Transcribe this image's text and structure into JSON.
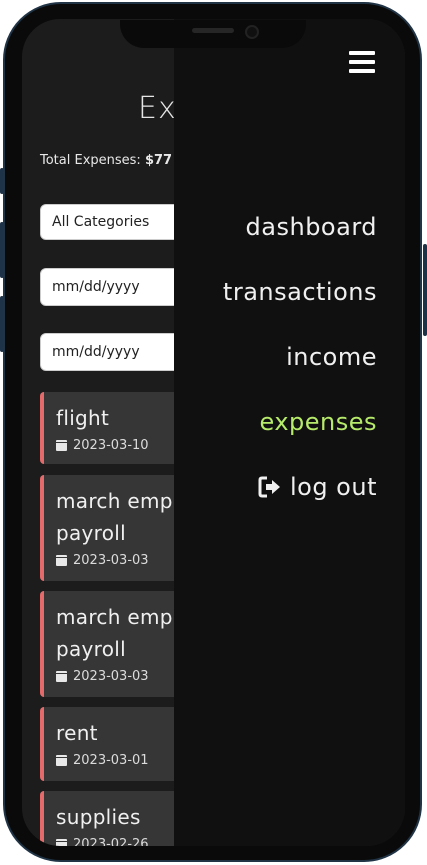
{
  "page": {
    "title": "Exp"
  },
  "summary": {
    "label": "Total Expenses: ",
    "value": "$77"
  },
  "filters": {
    "category": "All Categories",
    "date_from_placeholder": "mm/dd/yyyy",
    "date_to_placeholder": "mm/dd/yyyy"
  },
  "expenses": [
    {
      "title_lines": [
        "flight"
      ],
      "date": "2023-03-10"
    },
    {
      "title_lines": [
        "march emp",
        "payroll"
      ],
      "date": "2023-03-03"
    },
    {
      "title_lines": [
        "march emp",
        "payroll"
      ],
      "date": "2023-03-03"
    },
    {
      "title_lines": [
        "rent"
      ],
      "date": "2023-03-01"
    },
    {
      "title_lines": [
        "supplies"
      ],
      "date": "2023-02-26"
    }
  ],
  "menu": {
    "items": [
      "dashboard",
      "transactions",
      "income",
      "expenses"
    ],
    "active": "expenses",
    "logout": "log out"
  },
  "colors": {
    "accent_active": "#b6ea6a",
    "card_border": "#e36b6b"
  },
  "icons": {
    "menu": "hamburger-icon",
    "logout": "sign-out-icon",
    "date": "calendar-icon"
  }
}
